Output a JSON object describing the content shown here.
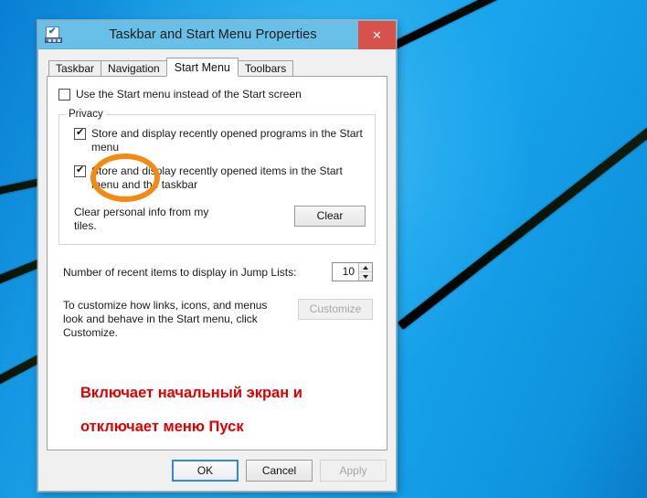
{
  "window": {
    "title": "Taskbar and Start Menu Properties",
    "icon": "taskbar-properties-icon",
    "close_label": "✕",
    "titlebar_color": "#68c0e8",
    "close_color": "#d6524a"
  },
  "tabs": [
    {
      "label": "Taskbar",
      "active": false
    },
    {
      "label": "Navigation",
      "active": false
    },
    {
      "label": "Start Menu",
      "active": true
    },
    {
      "label": "Toolbars",
      "active": false
    }
  ],
  "start_menu_tab": {
    "use_start_menu": {
      "label": "Use the Start menu instead of the Start screen",
      "checked": false
    },
    "privacy_group": {
      "legend": "Privacy",
      "checkboxes": [
        {
          "label": "Store and display recently opened programs in the Start menu",
          "checked": true
        },
        {
          "label": "Store and display recently opened items in the Start menu and the taskbar",
          "checked": true
        }
      ],
      "clear_text": "Clear personal info from my tiles.",
      "clear_button": "Clear"
    },
    "jump_lists": {
      "label": "Number of recent items to display in Jump Lists:",
      "value": "10",
      "up_arrow": "spinner-up-arrow",
      "down_arrow": "spinner-down-arrow"
    },
    "customize": {
      "text": "To customize how links, icons, and menus look and behave in the Start menu, click Customize.",
      "button": "Customize",
      "button_disabled": true
    },
    "annotation": {
      "line1": "Включает начальный экран и",
      "line2": "отключает меню Пуск",
      "color": "#e00000"
    },
    "highlight": {
      "shape": "ellipse",
      "color": "#f28a14",
      "target": "use-start-menu-checkbox"
    }
  },
  "footer": {
    "ok": "OK",
    "cancel": "Cancel",
    "apply": "Apply",
    "apply_disabled": true,
    "ok_focused": true
  },
  "desktop": {
    "wallpaper": "windows-blue-ribbon-wallpaper",
    "base_color": "#18a3ec",
    "stripe_color": "#0d1a0a"
  }
}
